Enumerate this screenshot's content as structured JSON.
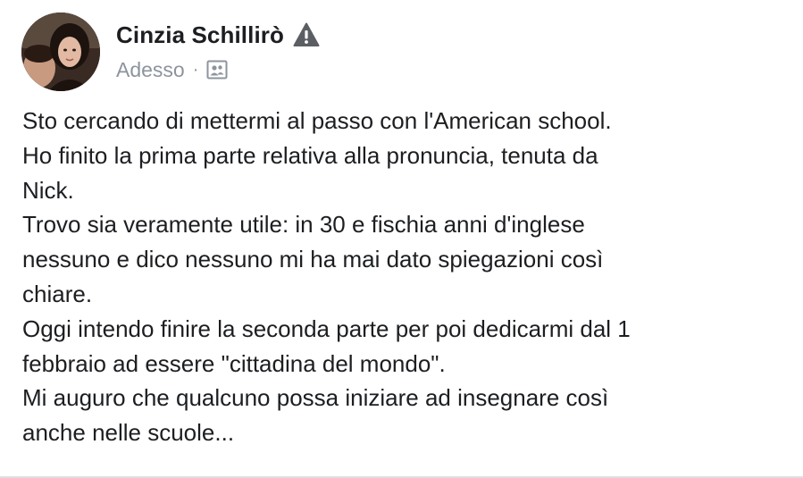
{
  "post": {
    "author_name": "Cinzia Schillirò",
    "timestamp": "Adesso",
    "separator": "·",
    "icons": {
      "warning": "warning-triangle-icon",
      "audience": "friends-audience-icon"
    },
    "colors": {
      "text": "#1c1e21",
      "meta": "#8d949e",
      "warning": "#5b5e63"
    },
    "text_lines": [
      "Sto cercando di mettermi al passo con l'American school.",
      "Ho finito la prima parte relativa alla pronuncia, tenuta da",
      "Nick.",
      "Trovo sia veramente utile: in 30 e fischia anni d'inglese",
      "nessuno e dico nessuno mi ha mai dato spiegazioni così",
      "chiare.",
      "Oggi intendo finire la seconda parte per poi dedicarmi dal 1",
      "febbraio ad essere \"cittadina del mondo\".",
      "Mi auguro che qualcuno possa iniziare ad insegnare così",
      "anche nelle scuole..."
    ]
  }
}
